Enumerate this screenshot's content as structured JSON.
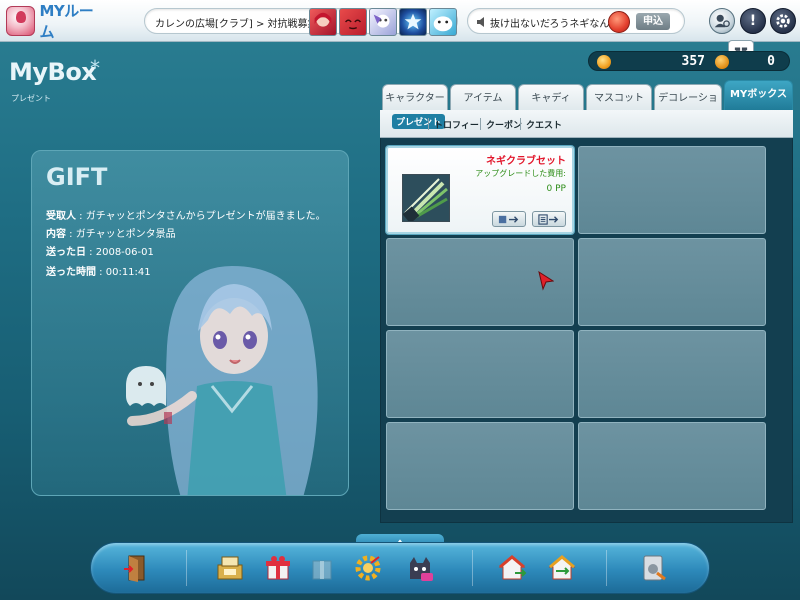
{
  "topbar": {
    "logo_text": "MYルーム",
    "location": "カレンの広場[クラブ] > 対抗戦募集",
    "message": "抜け出ないだろうネギなんぞ",
    "apply_label": "申込",
    "alert_symbol": "!"
  },
  "currency": {
    "points": "357",
    "gems": "0"
  },
  "page": {
    "title": "MyBox",
    "title_star": "*",
    "subtitle": "プレゼント"
  },
  "gift": {
    "title": "GIFT",
    "recipient_label": "受取人",
    "recipient_value": " : ガチャッとポンタさんからプレゼントが届きました。",
    "content_label": "内容",
    "content_value": " : ガチャッとポンタ景品",
    "sent_date_label": "送った日",
    "sent_date_value": " : 2008-06-01",
    "sent_time_label": "送った時間",
    "sent_time_value": " : 00:11:41"
  },
  "tabs": [
    {
      "label": "キャラクター"
    },
    {
      "label": "アイテム"
    },
    {
      "label": "キャディ"
    },
    {
      "label": "マスコット"
    },
    {
      "label": "デコレーション"
    },
    {
      "label": "MYボックス"
    }
  ],
  "subtabs": [
    {
      "label": "プレゼント"
    },
    {
      "label": "トロフィー"
    },
    {
      "label": "クーポン"
    },
    {
      "label": "クエスト"
    }
  ],
  "slots": [
    {
      "filled": true,
      "item_name": "ネギクラブセット",
      "item_note": "アップグレードした費用:",
      "item_price": "0 PP"
    }
  ],
  "icons": {
    "logo": "room-logo-icon",
    "speaker": "speaker-icon",
    "friend": "friend-icon",
    "alert": "alert-icon",
    "settings": "gear-icon",
    "gift": "gift-icon",
    "coin": "coin-icon",
    "gem": "gem-icon"
  },
  "dock": [
    {
      "name": "exit-door-icon"
    },
    {
      "name": "cash-register-icon"
    },
    {
      "name": "gift-box-icon"
    },
    {
      "name": "box-icon"
    },
    {
      "name": "gear-gold-icon"
    },
    {
      "name": "cat-mascot-icon"
    },
    {
      "name": "house-enter-icon"
    },
    {
      "name": "house-exchange-icon"
    },
    {
      "name": "settings-plug-icon"
    }
  ],
  "colors": {
    "accent": "#1f7a97",
    "item_name": "#e2162b",
    "item_price": "#2f8e1a"
  }
}
